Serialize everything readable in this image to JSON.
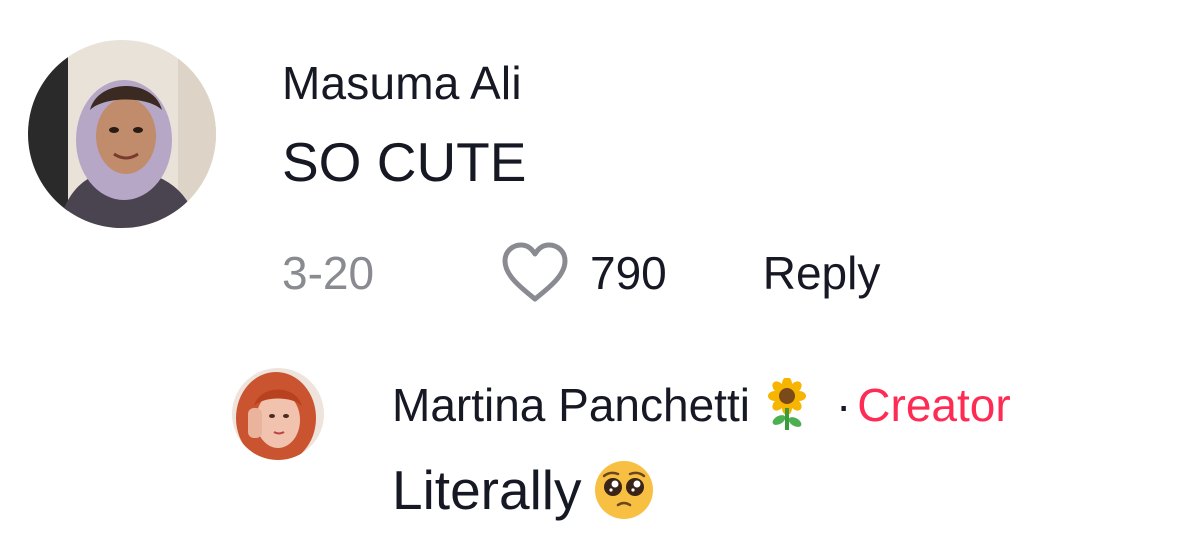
{
  "comment": {
    "username": "Masuma Ali",
    "text": "SO CUTE",
    "date": "3-20",
    "likes": "790",
    "reply_label": "Reply",
    "like_icon": "heart-outline-icon"
  },
  "reply": {
    "username": "Martina Panchetti",
    "username_emoji": "sunflower",
    "separator": "·",
    "badge": "Creator",
    "text": "Literally",
    "text_emoji": "pleading-face"
  },
  "colors": {
    "text": "#161823",
    "muted": "#8a8b91",
    "creator": "#fe2c55"
  }
}
